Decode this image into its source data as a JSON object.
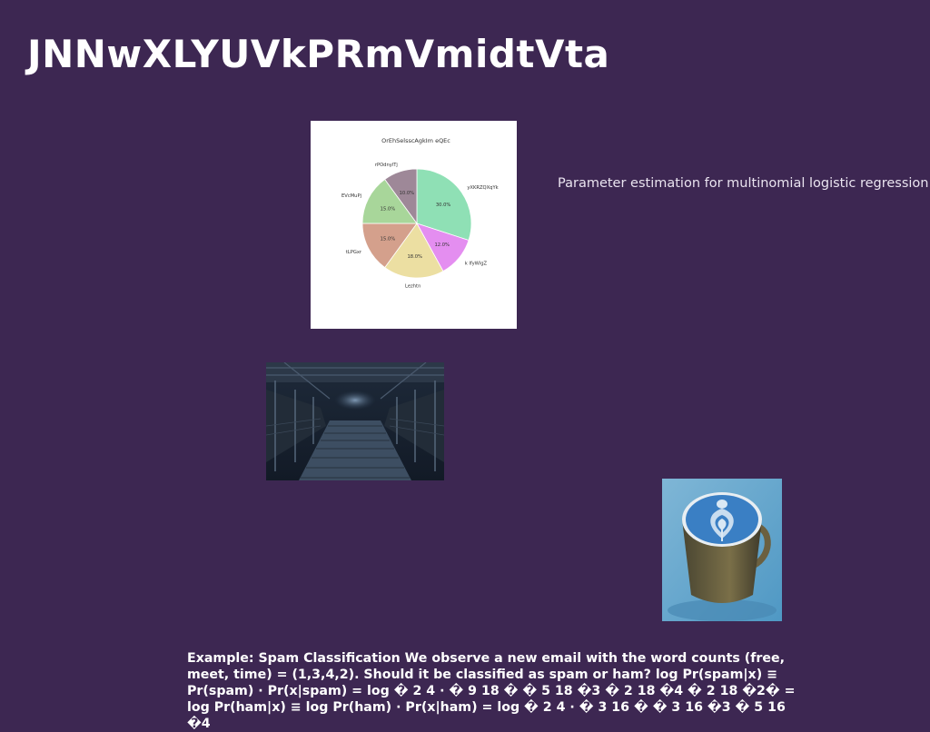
{
  "slide": {
    "title": "JNNwXLYUVkPRmVmidtVta",
    "paragraph": "Parameter estimation for multinomial logistic regression approach: Maximize conditional likelihood log P(D) = ∑ n",
    "example_text": "Example: Spam Classification We observe a new email with the word counts (free, meet, time) = (1,3,4,2). Should it be classified as spam or ham? log Pr(spam|x) ≡\nPr(spam) · Pr(x|spam) = log � 2 4 · � 9 18 � � 5 18 �3 � 2 18 �4 � 2 18 �2� =\nlog Pr(ham|x) ≡ log Pr(ham) · Pr(x|ham) = log � 2 4 · � 3 16 � � 3 16 �3 � 5 16 �4"
  },
  "images": {
    "bridge": "covered-wooden-bridge-photo",
    "coffee": "blue-latte-cup-photo"
  },
  "chart_data": {
    "type": "pie",
    "title": "OrEhSelsscAgkIm eQEc",
    "start_angle_deg": 90,
    "direction": "clockwise",
    "slices": [
      {
        "label": "yXKRZQXqYk",
        "value": 30.0,
        "pct_label": "30.0%",
        "color": "#8fe0b5"
      },
      {
        "label": "k IfyWlgZ",
        "value": 12.0,
        "pct_label": "12.0%",
        "color": "#e48ef0"
      },
      {
        "label": "Lezhtn",
        "value": 18.0,
        "pct_label": "18.0%",
        "color": "#ecdfa2"
      },
      {
        "label": "tLPGxr",
        "value": 15.0,
        "pct_label": "15.0%",
        "color": "#d4a08c"
      },
      {
        "label": "EVcMuPj",
        "value": 15.0,
        "pct_label": "15.0%",
        "color": "#a8d69a"
      },
      {
        "label": "rPOdnylTj",
        "value": 10.0,
        "pct_label": "10.0%",
        "color": "#9e8898"
      }
    ]
  }
}
